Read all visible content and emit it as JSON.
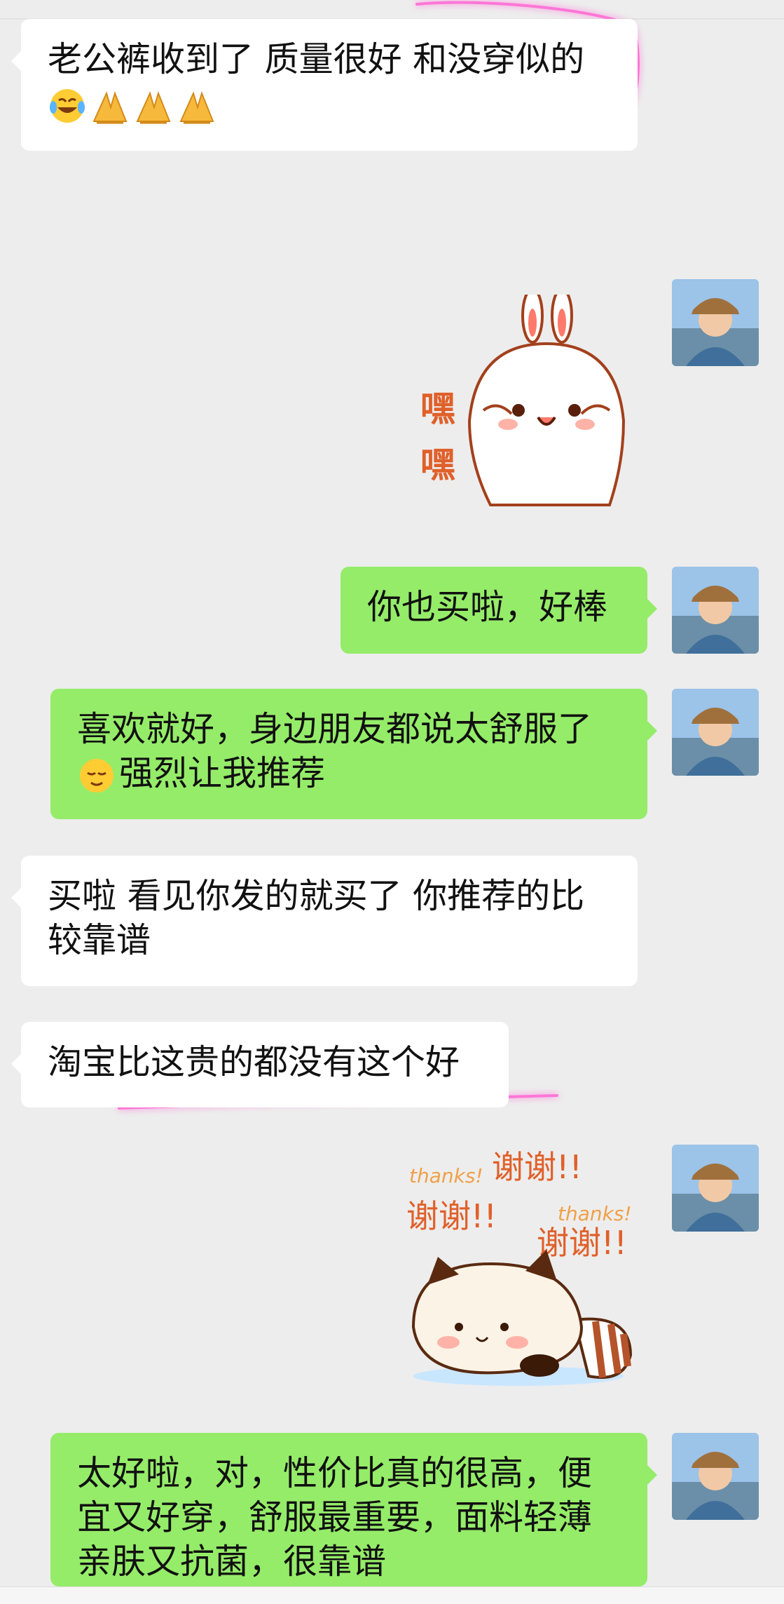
{
  "messages": [
    {
      "side": "left",
      "lines": [
        "老公裤收到了 质量很好 和没穿似的"
      ],
      "emoji_line": [
        "laugh-cry",
        "pray",
        "pray",
        "pray"
      ]
    },
    {
      "side": "right",
      "type": "sticker",
      "sticker": "bunny-heihei",
      "sticker_text": [
        "嘿",
        "嘿"
      ]
    },
    {
      "side": "right",
      "lines": [
        "你也买啦，好棒"
      ]
    },
    {
      "side": "right",
      "lines": [
        "喜欢就好，身边朋友都说太舒服了",
        "强烈让我推荐"
      ],
      "lead_emoji": "relieved"
    },
    {
      "side": "left",
      "lines": [
        "买啦 看见你发的就买了 你推荐的比",
        "较靠谱"
      ]
    },
    {
      "side": "left",
      "lines": [
        "淘宝比这贵的都没有这个好"
      ]
    },
    {
      "side": "right",
      "type": "sticker",
      "sticker": "raccoon-thanks",
      "sticker_text": [
        "thanks!",
        "谢谢!!",
        "谢谢!!",
        "thanks!",
        "谢谢!!"
      ]
    },
    {
      "side": "right",
      "lines": [
        "太好啦，对，性价比真的很高，便",
        "宜又好穿，舒服最重要，面料轻薄",
        "亲肤又抗菌，很靠谱"
      ]
    }
  ],
  "colors": {
    "background": "#ededed",
    "bubble_self": "#95ec69",
    "bubble_other": "#ffffff",
    "highlight": "#ff6ad5",
    "sticker_text": "#e0602a"
  }
}
